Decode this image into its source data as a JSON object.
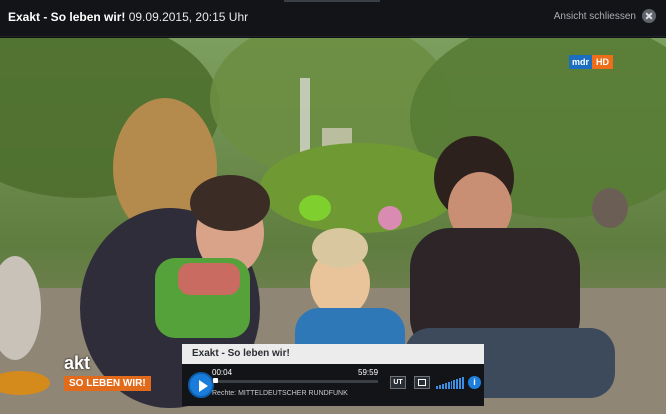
{
  "header": {
    "title_bold": "Exakt - So leben wir!",
    "title_rest": " 09.09.2015, 20:15 Uhr",
    "close_label": "Ansicht schliessen"
  },
  "video": {
    "channel_logo": "mdr",
    "channel_hd": "HD",
    "brand_akt": "akt",
    "brand_sub": "SO LEBEN WIR!"
  },
  "player": {
    "title": "Exakt - So leben wir!",
    "time_current": "00:04",
    "time_total": "59:59",
    "progress": 0.01,
    "rights": "Rechte: MITTELDEUTSCHER RUNDFUNK",
    "ut_label": "UT",
    "info_label": "i",
    "icons": [
      "play-icon",
      "fullscreen-icon",
      "volume-icon",
      "info-icon"
    ]
  },
  "colors": {
    "accent": "#1a7ddc",
    "brand_orange": "#e16a1b",
    "mdr_blue": "#1c6fc0"
  }
}
